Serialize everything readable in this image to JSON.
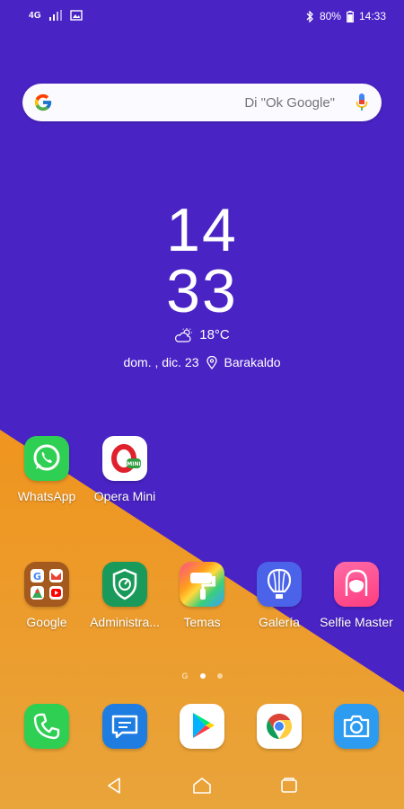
{
  "status_bar": {
    "network": "4G",
    "battery": "80%",
    "time": "14:33"
  },
  "search": {
    "placeholder": "Di \"Ok Google\""
  },
  "clock": {
    "hour": "14",
    "minute": "33"
  },
  "weather": {
    "temperature": "18°C",
    "icon": "partly-cloudy-icon"
  },
  "date": {
    "text": "dom. , dic. 23",
    "location": "Barakaldo"
  },
  "apps_row1": [
    {
      "label": "WhatsApp"
    },
    {
      "label": "Opera Mini"
    }
  ],
  "apps_row2": [
    {
      "label": "Google"
    },
    {
      "label": "Administra..."
    },
    {
      "label": "Temas"
    },
    {
      "label": "Galería"
    },
    {
      "label": "Selfie Master"
    }
  ],
  "page_indicator": {
    "google_page": "G",
    "pages": 2,
    "active": 0
  },
  "dock": [
    {
      "name": "phone"
    },
    {
      "name": "messages"
    },
    {
      "name": "play-store"
    },
    {
      "name": "chrome"
    },
    {
      "name": "camera"
    }
  ],
  "colors": {
    "background_top": "#4a23c5",
    "background_bottom": "#ef9520"
  }
}
